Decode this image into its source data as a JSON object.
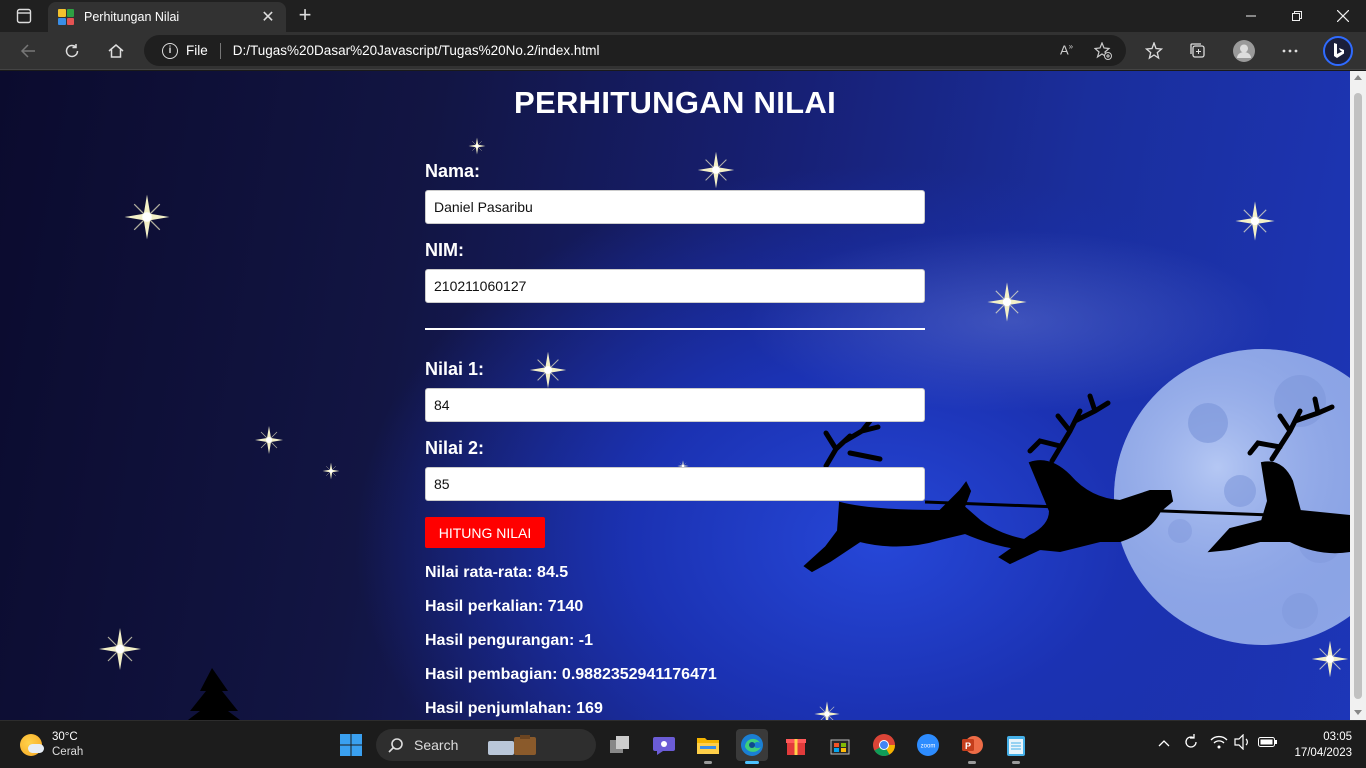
{
  "browser": {
    "tab_title": "Perhitungan Nilai",
    "address_scheme": "File",
    "address_url": "D:/Tugas%20Dasar%20Javascript/Tugas%20No.2/index.html"
  },
  "page": {
    "title": "PERHITUNGAN NILAI",
    "fields": {
      "nama_label": "Nama:",
      "nama_value": "Daniel Pasaribu",
      "nim_label": "NIM:",
      "nim_value": "210211060127",
      "nilai1_label": "Nilai 1:",
      "nilai1_value": "84",
      "nilai2_label": "Nilai 2:",
      "nilai2_value": "85"
    },
    "button_label": "HITUNG NILAI",
    "results": {
      "rata_rata": "Nilai rata-rata: 84.5",
      "perkalian": "Hasil perkalian: 7140",
      "pengurangan": "Hasil pengurangan: -1",
      "pembagian": "Hasil pembagian: 0.9882352941176471",
      "penjumlahan": "Hasil penjumlahan: 169"
    },
    "colors": {
      "button_bg": "#ff0000",
      "text": "#ffffff",
      "background_dark": "#0b0b2e",
      "background_blue": "#1d36b8"
    }
  },
  "taskbar": {
    "weather_temp": "30°C",
    "weather_condition": "Cerah",
    "search_label": "Search",
    "time": "03:05",
    "date": "17/04/2023"
  }
}
